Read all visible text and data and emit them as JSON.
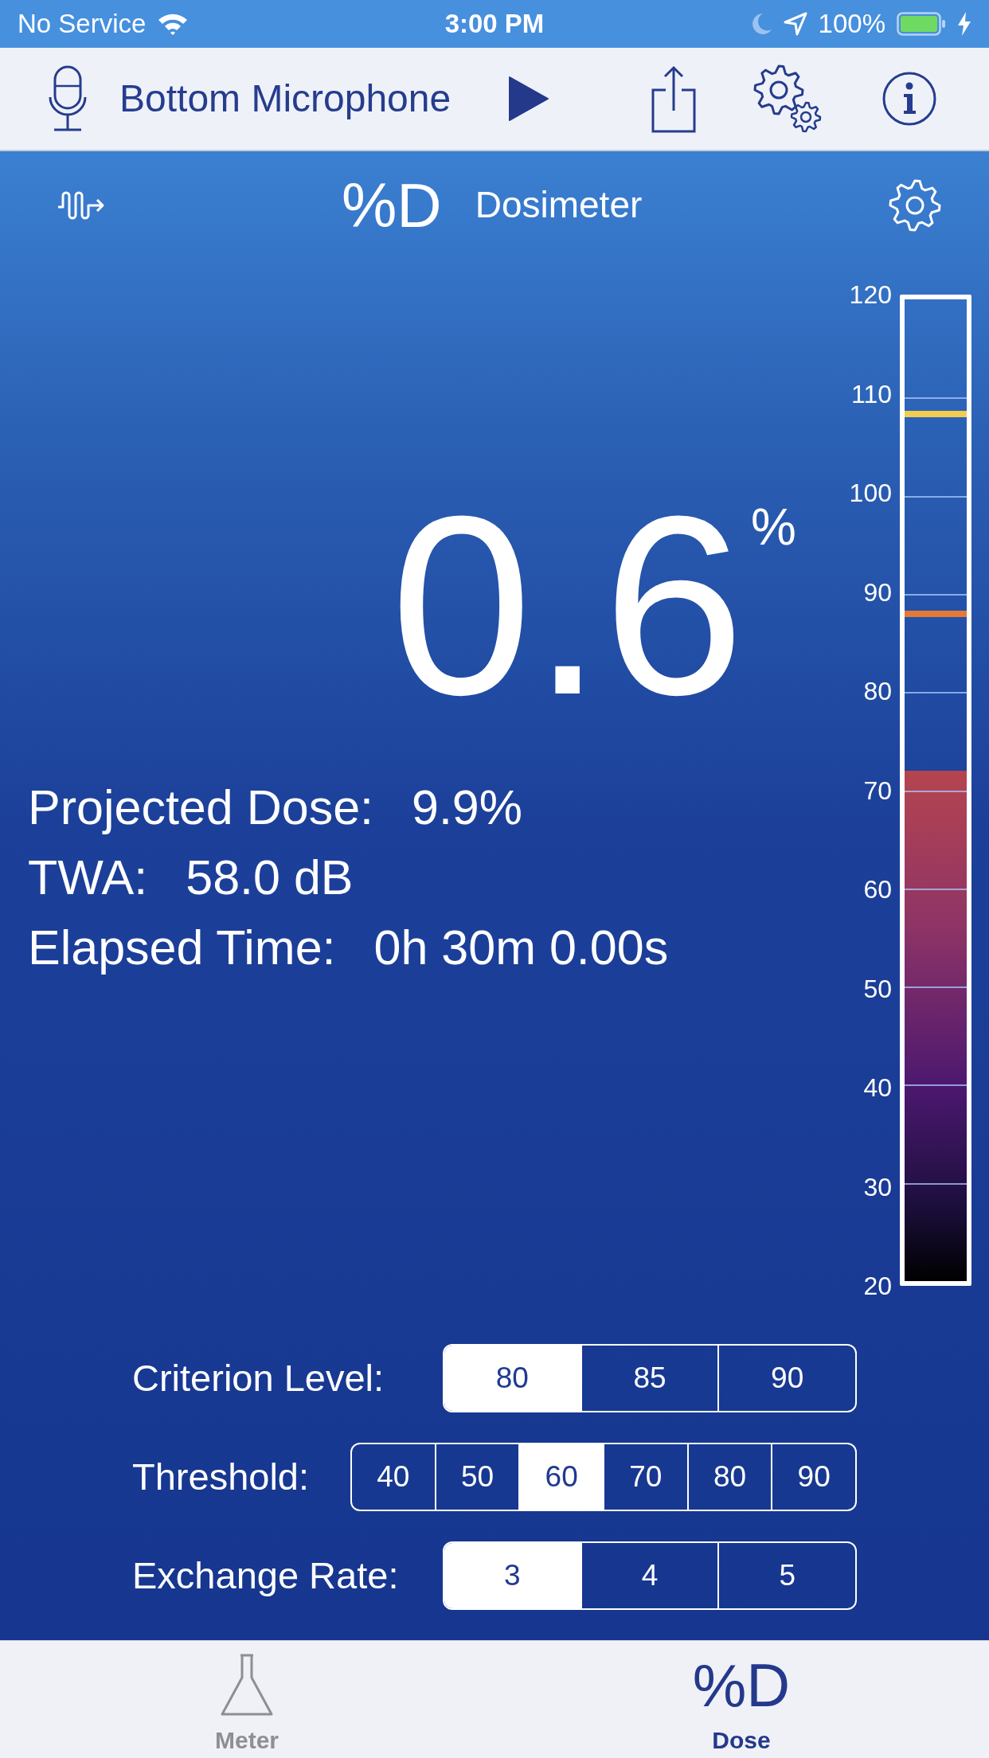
{
  "status_bar": {
    "carrier": "No Service",
    "time": "3:00 PM",
    "battery": "100%"
  },
  "toolbar": {
    "input": "Bottom Microphone"
  },
  "header": {
    "mode_icon": "%D",
    "title": "Dosimeter"
  },
  "readout": {
    "value": "0.6",
    "unit": "%"
  },
  "stats": [
    {
      "label": "Projected Dose:",
      "value": "9.9%"
    },
    {
      "label": "TWA:",
      "value": "58.0 dB"
    },
    {
      "label": "Elapsed Time:",
      "value": "0h 30m 0.00s"
    }
  ],
  "meter": {
    "ticks": [
      "120",
      "110",
      "100",
      "90",
      "80",
      "70",
      "60",
      "50",
      "40",
      "30",
      "20"
    ],
    "level": 0.52,
    "markers": [
      {
        "color": "#f2cd4f",
        "level": 0.883
      },
      {
        "color": "#e47a36",
        "level": 0.68
      }
    ]
  },
  "settings": [
    {
      "label": "Criterion Level:",
      "options": [
        {
          "label": "80",
          "selected": true
        },
        {
          "label": "85",
          "selected": false
        },
        {
          "label": "90",
          "selected": false
        }
      ]
    },
    {
      "label": "Threshold:",
      "options": [
        {
          "label": "40",
          "selected": false
        },
        {
          "label": "50",
          "selected": false
        },
        {
          "label": "60",
          "selected": true
        },
        {
          "label": "70",
          "selected": false
        },
        {
          "label": "80",
          "selected": false
        },
        {
          "label": "90",
          "selected": false
        }
      ]
    },
    {
      "label": "Exchange Rate:",
      "options": [
        {
          "label": "3",
          "selected": true
        },
        {
          "label": "4",
          "selected": false
        },
        {
          "label": "5",
          "selected": false
        }
      ]
    }
  ],
  "tabs": [
    {
      "kind": "flask",
      "label": "Meter",
      "selected": false
    },
    {
      "kind": "glyph",
      "glyph": "%D",
      "label": "Dose",
      "selected": true
    }
  ]
}
